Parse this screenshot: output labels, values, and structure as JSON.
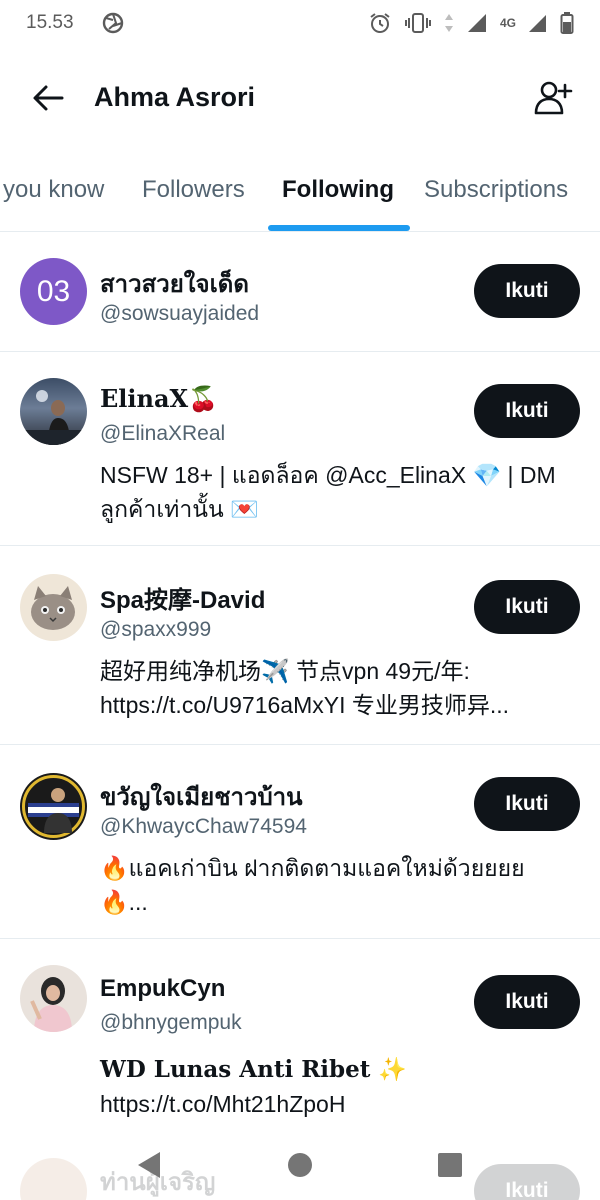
{
  "status_bar": {
    "time": "15.53",
    "network": "4G"
  },
  "header": {
    "title": "Ahma Asrori"
  },
  "tabs": [
    {
      "label": "you know",
      "active": false
    },
    {
      "label": "Followers",
      "active": false
    },
    {
      "label": "Following",
      "active": true
    },
    {
      "label": "Subscriptions",
      "active": false
    }
  ],
  "users": [
    {
      "name": "สาวสวยใจเด็ด",
      "handle": "@sowsuayjaided",
      "avatar_text": "03",
      "bio_line1": "",
      "bio_line2": "",
      "follow_label": "Ikuti"
    },
    {
      "name": "ElinaX🍒",
      "handle": "@ElinaXReal",
      "bio_line1": "NSFW 18+ | แอดล็อค @Acc_ElinaX 💎 | DM",
      "bio_line2": "ลูกค้าเท่านั้น 💌",
      "follow_label": "Ikuti"
    },
    {
      "name": "Spa按摩-David",
      "handle": "@spaxx999",
      "bio_line1": "超好用纯净机场✈️ 节点vpn 49元/年:",
      "bio_line2": "https://t.co/U9716aMxYI 专业男技师异...",
      "follow_label": "Ikuti"
    },
    {
      "name": "ขวัญใจเมียชาวบ้าน",
      "handle": "@KhwaycChaw74594",
      "bio_line1": "🔥แอคเก่าบิน ฝากติดตามแอคใหม่ด้วยยยย",
      "bio_line2": "🔥...",
      "follow_label": "Ikuti"
    },
    {
      "name": "EmpukCyn",
      "handle": "@bhnygempuk",
      "bio_line1": "WD Lunas Anti Ribet ✨",
      "bio_line2": "https://t.co/Mht21hZpoH",
      "follow_label": "Ikuti"
    },
    {
      "name": "ท่านผู้เจริญ",
      "follow_label": "Ikuti"
    }
  ],
  "colors": {
    "accent": "#1d9bf0",
    "button_bg": "#0f1419",
    "secondary_text": "#536471",
    "avatar_initials_bg": "#7e58c7"
  }
}
